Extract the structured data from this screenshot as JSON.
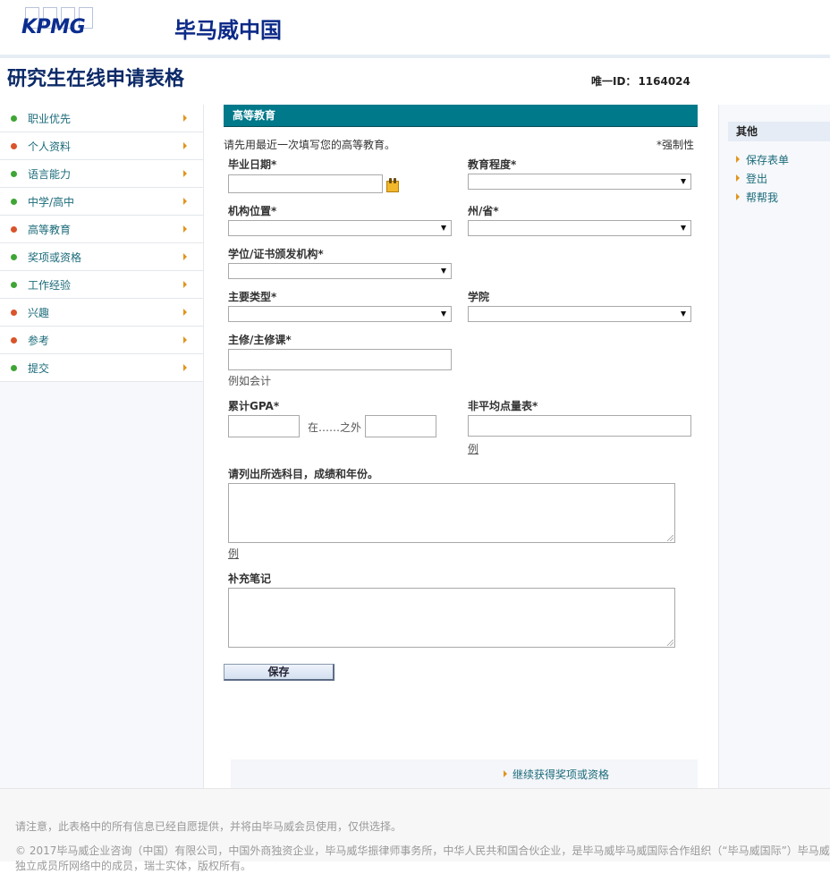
{
  "header": {
    "logo_text": "KPMG",
    "brand": "毕马威中国"
  },
  "page": {
    "title": "研究生在线申请表格",
    "uid_label": "唯一ID：",
    "uid_value": "1164024"
  },
  "sidebar": {
    "items": [
      {
        "label": "职业优先",
        "status": "green"
      },
      {
        "label": "个人资料",
        "status": "red"
      },
      {
        "label": "语言能力",
        "status": "green"
      },
      {
        "label": "中学/高中",
        "status": "green"
      },
      {
        "label": "高等教育",
        "status": "red"
      },
      {
        "label": "奖项或资格",
        "status": "green"
      },
      {
        "label": "工作经验",
        "status": "green"
      },
      {
        "label": "兴趣",
        "status": "red"
      },
      {
        "label": "参考",
        "status": "red"
      },
      {
        "label": "提交",
        "status": "green"
      }
    ]
  },
  "form": {
    "section_title": "高等教育",
    "intro": "请先用最近一次填写您的高等教育。",
    "required_note": "*强制性",
    "graduation_date_label": "毕业日期*",
    "graduation_date_value": "",
    "education_level_label": "教育程度*",
    "education_level_value": "",
    "institution_location_label": "机构位置*",
    "institution_location_value": "",
    "state_label": "州/省*",
    "state_value": "",
    "degree_issuer_label": "学位/证书颁发机构*",
    "degree_issuer_value": "",
    "major_type_label": "主要类型*",
    "major_type_value": "",
    "college_label": "学院",
    "college_value": "",
    "major_label": "主修/主修课*",
    "major_value": "",
    "major_hint": "例如会计",
    "gpa_label": "累计GPA*",
    "gpa_value": "",
    "gpa_out_of_label": "在……之外",
    "gpa_out_of_value": "",
    "non_gpa_label": "非平均点量表*",
    "non_gpa_value": "",
    "non_gpa_hint": "例",
    "subjects_label": "请列出所选科目，成绩和年份。",
    "subjects_value": "",
    "subjects_hint": "例",
    "notes_label": "补充笔记",
    "notes_value": "",
    "save_label": "保存",
    "continue_label": "继续获得奖项或资格"
  },
  "right_panel": {
    "title": "其他",
    "items": [
      "保存表单",
      "登出",
      "帮帮我"
    ]
  },
  "footer": {
    "note": "请注意，此表格中的所有信息已经自愿提供，并将由毕马威会员使用，仅供选择。",
    "copyright": "© 2017毕马威企业咨询（中国）有限公司，中国外商独资企业，毕马威华振律师事务所，中华人民共和国合伙企业，是毕马威毕马威国际合作组织（“毕马威国际”）毕马威独立成员所网络中的成员，瑞士实体，版权所有。"
  },
  "colors": {
    "section_bar": "#00798a",
    "link": "#1b6b7a",
    "arrow": "#e0951e",
    "status_green": "#3fa535",
    "status_red": "#d9542b",
    "brand_blue": "#0c2a88"
  }
}
